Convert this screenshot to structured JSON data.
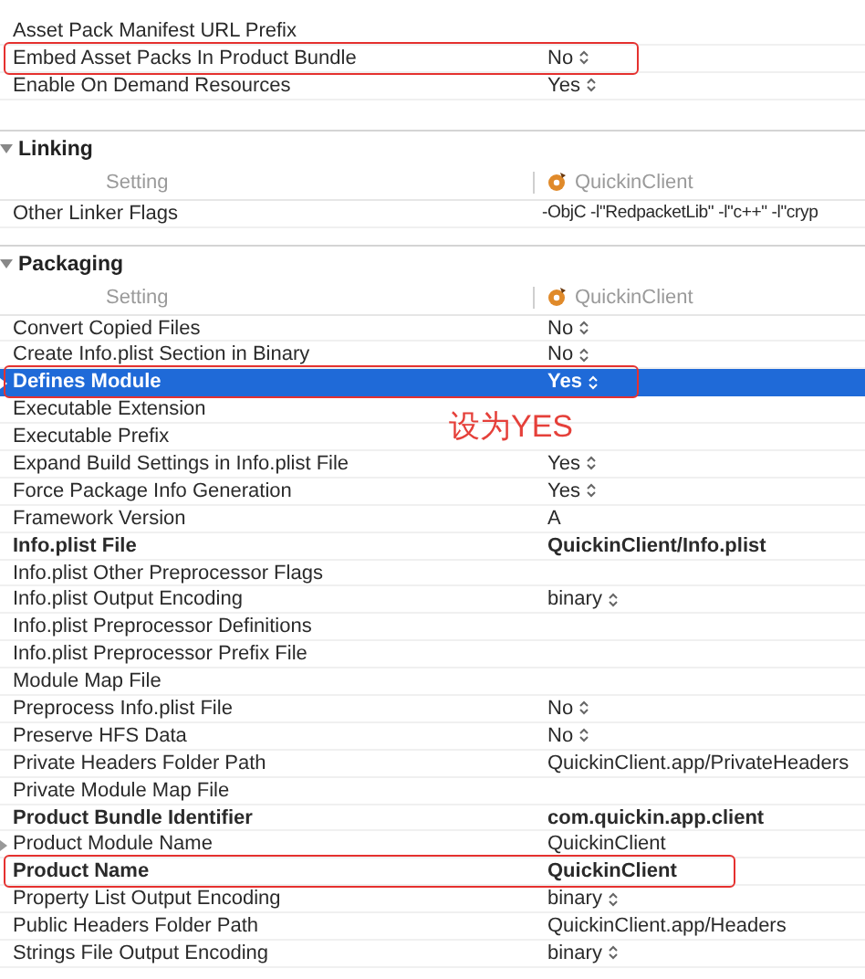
{
  "sections": [
    {
      "rows": [
        {
          "label": "Asset Pack Manifest URL Prefix",
          "bold": false,
          "selected": false,
          "circled": false,
          "disclosure": false
        },
        {
          "label": "Embed Asset Packs In Product Bundle",
          "value": "No",
          "bold": false,
          "popup": true,
          "selected": false,
          "circled": true,
          "disclosure": false
        },
        {
          "label": "Enable On Demand Resources",
          "value": "Yes",
          "bold": false,
          "popup": true,
          "selected": false,
          "circled": false,
          "disclosure": false
        }
      ]
    },
    {
      "title": "Linking",
      "expanded": true,
      "header": {
        "setting": "Setting",
        "target": "QuickinClient"
      },
      "rows": [
        {
          "label": "Other Linker Flags",
          "value": "-ObjC -l\"RedpacketLib\" -l\"c++\" -l\"cryp",
          "bold": false,
          "popup": false,
          "selected": false,
          "circled": false,
          "disclosure": false
        }
      ]
    },
    {
      "title": "Packaging",
      "expanded": true,
      "header": {
        "setting": "Setting",
        "target": "QuickinClient"
      },
      "rows": [
        {
          "label": "Convert Copied Files",
          "value": "No",
          "bold": false,
          "popup": true,
          "selected": false,
          "circled": false,
          "disclosure": false
        },
        {
          "label": "Create Info.plist Section in Binary",
          "value": "No",
          "bold": false,
          "popup": true,
          "selected": false,
          "circled": false,
          "disclosure": false
        },
        {
          "label": "Defines Module",
          "value": "Yes",
          "bold": true,
          "popup": true,
          "selected": true,
          "circled": true,
          "disclosure": true
        },
        {
          "label": "Executable Extension",
          "bold": false,
          "selected": false,
          "circled": false,
          "disclosure": false
        },
        {
          "label": "Executable Prefix",
          "bold": false,
          "selected": false,
          "circled": false,
          "disclosure": false
        },
        {
          "label": "Expand Build Settings in Info.plist File",
          "value": "Yes",
          "bold": false,
          "popup": true,
          "selected": false,
          "circled": false,
          "disclosure": false
        },
        {
          "label": "Force Package Info Generation",
          "value": "Yes",
          "bold": false,
          "popup": true,
          "selected": false,
          "circled": false,
          "disclosure": false
        },
        {
          "label": "Framework Version",
          "value": "A",
          "bold": false,
          "popup": false,
          "selected": false,
          "circled": false,
          "disclosure": false
        },
        {
          "label": "Info.plist File",
          "value": "QuickinClient/Info.plist",
          "bold": true,
          "popup": false,
          "selected": false,
          "circled": false,
          "disclosure": false
        },
        {
          "label": "Info.plist Other Preprocessor Flags",
          "bold": false,
          "selected": false,
          "circled": false,
          "disclosure": false
        },
        {
          "label": "Info.plist Output Encoding",
          "value": "binary",
          "bold": false,
          "popup": true,
          "selected": false,
          "circled": false,
          "disclosure": false
        },
        {
          "label": "Info.plist Preprocessor Definitions",
          "bold": false,
          "selected": false,
          "circled": false,
          "disclosure": false
        },
        {
          "label": "Info.plist Preprocessor Prefix File",
          "bold": false,
          "selected": false,
          "circled": false,
          "disclosure": false
        },
        {
          "label": "Module Map File",
          "bold": false,
          "selected": false,
          "circled": false,
          "disclosure": false
        },
        {
          "label": "Preprocess Info.plist File",
          "value": "No",
          "bold": false,
          "popup": true,
          "selected": false,
          "circled": false,
          "disclosure": false
        },
        {
          "label": "Preserve HFS Data",
          "value": "No",
          "bold": false,
          "popup": true,
          "selected": false,
          "circled": false,
          "disclosure": false
        },
        {
          "label": "Private Headers Folder Path",
          "value": "QuickinClient.app/PrivateHeaders",
          "bold": false,
          "popup": false,
          "selected": false,
          "circled": false,
          "disclosure": false
        },
        {
          "label": "Private Module Map File",
          "bold": false,
          "selected": false,
          "circled": false,
          "disclosure": false
        },
        {
          "label": "Product Bundle Identifier",
          "value": "com.quickin.app.client",
          "bold": true,
          "popup": false,
          "selected": false,
          "circled": false,
          "disclosure": false
        },
        {
          "label": "Product Module Name",
          "value": "QuickinClient",
          "bold": false,
          "popup": false,
          "selected": false,
          "circled": false,
          "disclosure": true
        },
        {
          "label": "Product Name",
          "value": "QuickinClient",
          "bold": true,
          "popup": false,
          "selected": false,
          "circled": true,
          "disclosure": false
        },
        {
          "label": "Property List Output Encoding",
          "value": "binary",
          "bold": false,
          "popup": true,
          "selected": false,
          "circled": false,
          "disclosure": false
        },
        {
          "label": "Public Headers Folder Path",
          "value": "QuickinClient.app/Headers",
          "bold": false,
          "popup": false,
          "selected": false,
          "circled": false,
          "disclosure": false
        },
        {
          "label": "Strings File Output Encoding",
          "value": "binary",
          "bold": false,
          "popup": true,
          "selected": false,
          "circled": false,
          "disclosure": false
        }
      ]
    }
  ],
  "annotation": {
    "text": "设为YES"
  }
}
